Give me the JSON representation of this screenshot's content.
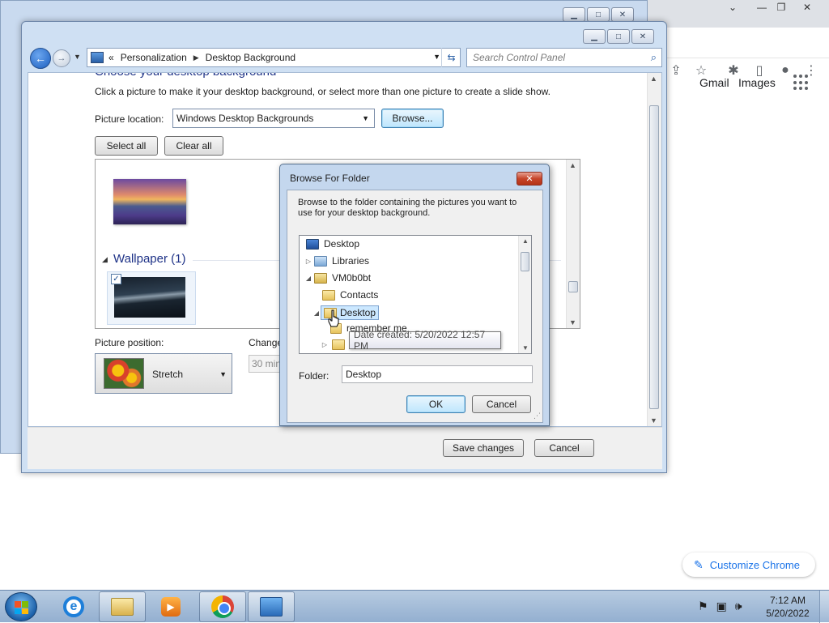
{
  "chrome": {
    "links": [
      "Gmail",
      "Images"
    ],
    "customize_label": "Customize Chrome"
  },
  "window": {
    "breadcrumb": [
      "Personalization",
      "Desktop Background"
    ],
    "search_placeholder": "Search Control Panel",
    "heading": "Choose your desktop background",
    "description": "Click a picture to make it your desktop background, or select more than one picture to create a slide show.",
    "picture_location_label": "Picture location:",
    "picture_location_value": "Windows Desktop Backgrounds",
    "browse_label": "Browse...",
    "select_all_label": "Select all",
    "clear_all_label": "Clear all",
    "group_label": "Wallpaper (1)",
    "picture_position_label": "Picture position:",
    "picture_position_value": "Stretch",
    "change_label": "Change",
    "interval_value": "30 min",
    "save_label": "Save changes",
    "cancel_label": "Cancel"
  },
  "dialog": {
    "title": "Browse For Folder",
    "description": "Browse to the folder containing the pictures you want to use for your desktop background.",
    "tree": [
      {
        "label": "Desktop",
        "icon": "desktop-icon"
      },
      {
        "label": "Libraries",
        "icon": "libraries-icon"
      },
      {
        "label": "VM0b0bt",
        "icon": "user-folder-icon"
      },
      {
        "label": "Contacts",
        "icon": "folder-icon"
      },
      {
        "label": "Desktop",
        "icon": "folder-icon",
        "selected": true
      },
      {
        "label": "remember me",
        "icon": "folder-icon"
      }
    ],
    "tooltip": "Date created: 5/20/2022 12:57 PM",
    "folder_label": "Folder:",
    "folder_value": "Desktop",
    "ok_label": "OK",
    "cancel_label": "Cancel"
  },
  "taskbar": {
    "time": "7:12 AM",
    "date": "5/20/2022"
  }
}
